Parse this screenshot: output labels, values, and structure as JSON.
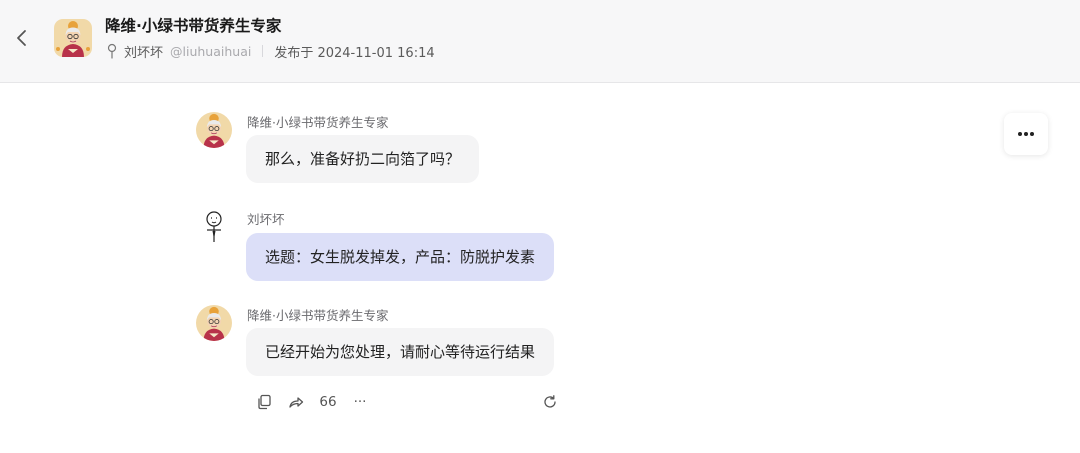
{
  "header": {
    "title": "降维·小绿书带货养生专家",
    "author_name": "刘坏坏",
    "author_handle": "@liuhuaihuai",
    "published": "发布于 2024-11-01 16:14"
  },
  "messages": [
    {
      "sender": "降维·小绿书带货养生专家",
      "text": "那么，准备好扔二向箔了吗？"
    },
    {
      "sender": "刘坏坏",
      "text": "选题：女生脱发掉发，产品：防脱护发素"
    },
    {
      "sender": "降维·小绿书带货养生专家",
      "text": "已经开始为您处理，请耐心等待运行结果"
    }
  ],
  "actions": {
    "quote_label": "66",
    "more_label": "···"
  },
  "icons": [
    "back-icon",
    "pin-icon",
    "more-options-icon",
    "copy-icon",
    "share-icon",
    "regenerate-icon"
  ],
  "colors": {
    "header_bg": "#f7f7f8",
    "bot_bubble": "#f4f4f5",
    "user_bubble": "#dcdff8"
  }
}
